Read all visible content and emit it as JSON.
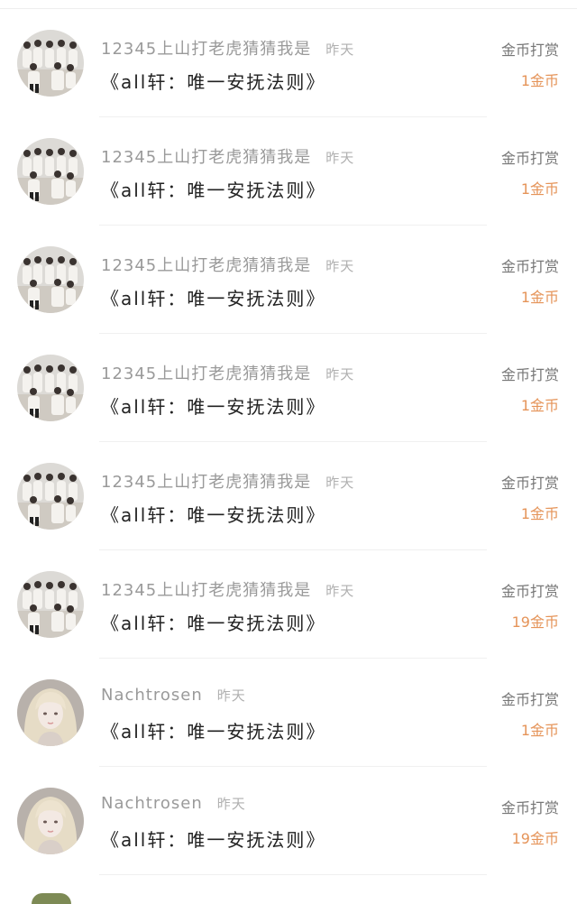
{
  "comments": [
    {
      "user": "12345上山打老虎猜猜我是",
      "time": "昨天",
      "book": "《all轩：唯一安抚法则》",
      "tip_label": "金币打赏",
      "amount": "1金币",
      "avatar": "group-photo"
    },
    {
      "user": "12345上山打老虎猜猜我是",
      "time": "昨天",
      "book": "《all轩：唯一安抚法则》",
      "tip_label": "金币打赏",
      "amount": "1金币",
      "avatar": "group-photo"
    },
    {
      "user": "12345上山打老虎猜猜我是",
      "time": "昨天",
      "book": "《all轩：唯一安抚法则》",
      "tip_label": "金币打赏",
      "amount": "1金币",
      "avatar": "group-photo"
    },
    {
      "user": "12345上山打老虎猜猜我是",
      "time": "昨天",
      "book": "《all轩：唯一安抚法则》",
      "tip_label": "金币打赏",
      "amount": "1金币",
      "avatar": "group-photo"
    },
    {
      "user": "12345上山打老虎猜猜我是",
      "time": "昨天",
      "book": "《all轩：唯一安抚法则》",
      "tip_label": "金币打赏",
      "amount": "1金币",
      "avatar": "group-photo"
    },
    {
      "user": "12345上山打老虎猜猜我是",
      "time": "昨天",
      "book": "《all轩：唯一安抚法则》",
      "tip_label": "金币打赏",
      "amount": "19金币",
      "avatar": "group-photo"
    },
    {
      "user": "Nachtrosen",
      "time": "昨天",
      "book": "《all轩：唯一安抚法则》",
      "tip_label": "金币打赏",
      "amount": "1金币",
      "avatar": "blonde-portrait"
    },
    {
      "user": "Nachtrosen",
      "time": "昨天",
      "book": "《all轩：唯一安抚法则》",
      "tip_label": "金币打赏",
      "amount": "19金币",
      "avatar": "blonde-portrait"
    }
  ],
  "colors": {
    "amount": "#e59459",
    "name": "#9a9a9a",
    "title": "#222222",
    "divider": "#f0f0f0"
  }
}
